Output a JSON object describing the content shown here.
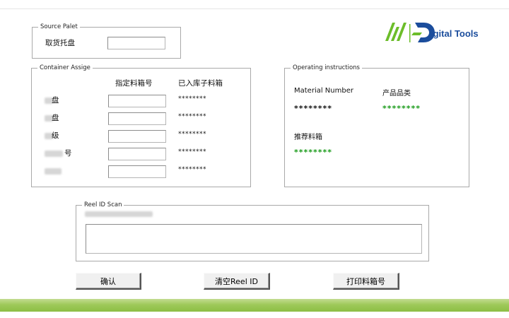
{
  "source_pallet": {
    "legend": "Source Palet",
    "label": "取货托盘",
    "value": ""
  },
  "container_assign": {
    "legend": "Container Assige",
    "col_assigned": "指定料箱号",
    "col_stocked": "已入库子料箱",
    "rows": [
      {
        "label": "盘",
        "value": "",
        "stocked": "********"
      },
      {
        "label": "盘",
        "value": "",
        "stocked": "********"
      },
      {
        "label": "级",
        "value": "",
        "stocked": "********"
      },
      {
        "label": "号",
        "value": "",
        "stocked": "********"
      },
      {
        "label": "",
        "value": "",
        "stocked": "********"
      }
    ]
  },
  "operating_instructions": {
    "legend": "Operating instructions",
    "material_number_label": "Material Number",
    "material_number_value": "********",
    "category_label": "产品品类",
    "category_value": "********",
    "recommended_label": "推荐料箱",
    "recommended_value": "********"
  },
  "reel_scan": {
    "legend": "Reel ID Scan",
    "value": ""
  },
  "buttons": {
    "confirm": "确认",
    "clear_reel": "清空Reel ID",
    "print_box": "打印料箱号"
  },
  "logo": {
    "text": "igital Tools",
    "color": "#1b4d9c",
    "accent": "#6cbd2a"
  },
  "colors": {
    "footer": "#9fc95a",
    "value_green": "#1a9b1a"
  }
}
